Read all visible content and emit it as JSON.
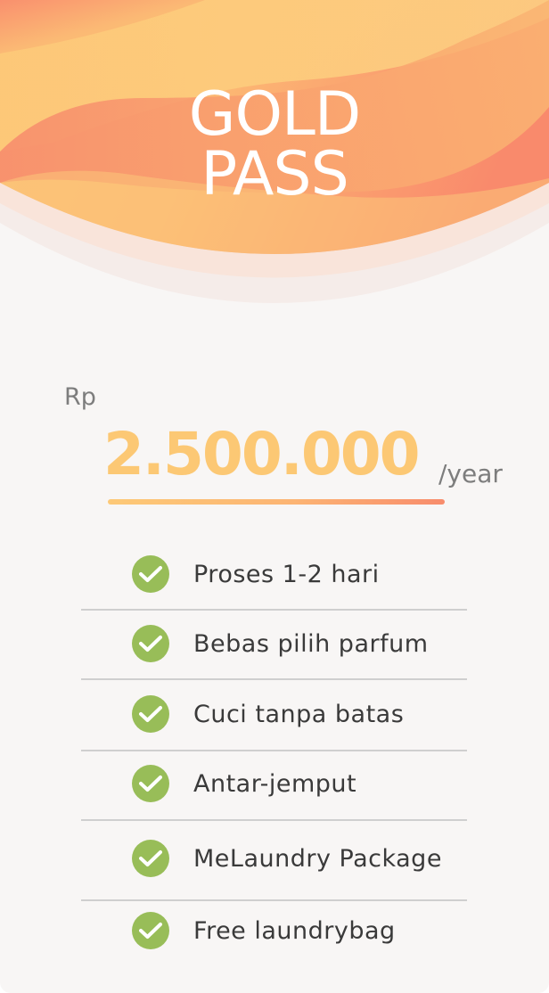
{
  "header": {
    "title_line1": "GOLD",
    "title_line2": "PASS"
  },
  "pricing": {
    "currency": "Rp",
    "amount": "2.500.000",
    "period": "/year"
  },
  "features": [
    {
      "label": "Proses 1-2 hari",
      "icon": "check-circle-icon"
    },
    {
      "label": "Bebas pilih parfum",
      "icon": "check-circle-icon"
    },
    {
      "label": "Cuci tanpa batas",
      "icon": "check-circle-icon"
    },
    {
      "label": "Antar-jemput",
      "icon": "check-circle-icon"
    },
    {
      "label": "MeLaundry Package",
      "icon": "check-circle-icon"
    },
    {
      "label": "Free laundrybag",
      "icon": "check-circle-icon"
    }
  ],
  "colors": {
    "background": "#f8f6f5",
    "wave_peach": "#fcb873",
    "wave_coral": "#f98a6c",
    "price": "#fcc874",
    "check": "#98bd58",
    "muted_text": "#7d7d7d",
    "feature_text": "#3a3a3a"
  }
}
